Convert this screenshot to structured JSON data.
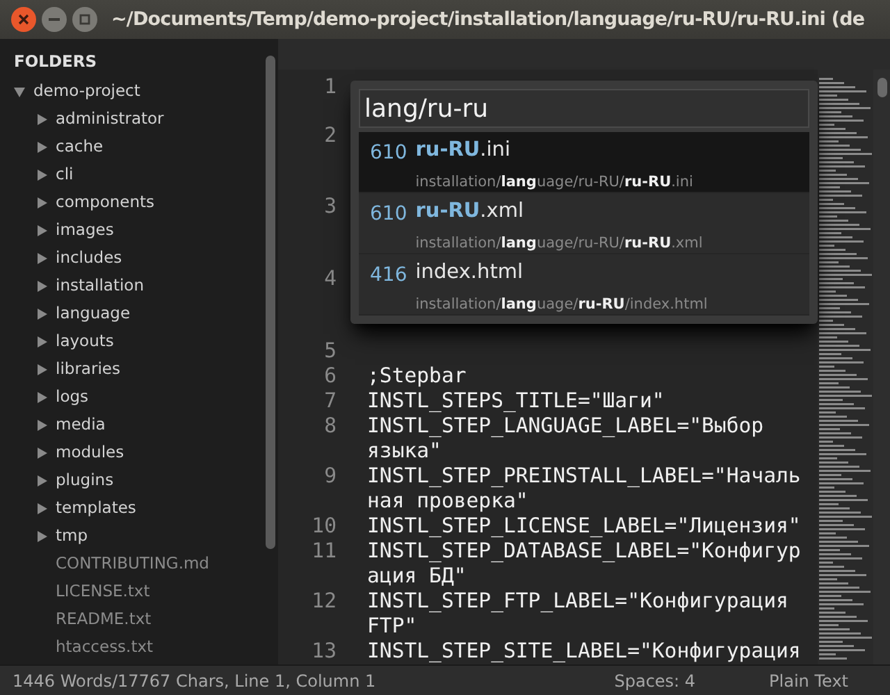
{
  "window": {
    "title": "~/Documents/Temp/demo-project/installation/language/ru-RU/ru-RU.ini (de"
  },
  "sidebar": {
    "heading": "FOLDERS",
    "tree": [
      {
        "label": "demo-project",
        "kind": "folder",
        "expanded": true,
        "children": [
          {
            "label": "administrator",
            "kind": "folder",
            "expanded": false
          },
          {
            "label": "cache",
            "kind": "folder",
            "expanded": false
          },
          {
            "label": "cli",
            "kind": "folder",
            "expanded": false
          },
          {
            "label": "components",
            "kind": "folder",
            "expanded": false
          },
          {
            "label": "images",
            "kind": "folder",
            "expanded": false
          },
          {
            "label": "includes",
            "kind": "folder",
            "expanded": false
          },
          {
            "label": "installation",
            "kind": "folder",
            "expanded": false
          },
          {
            "label": "language",
            "kind": "folder",
            "expanded": false
          },
          {
            "label": "layouts",
            "kind": "folder",
            "expanded": false
          },
          {
            "label": "libraries",
            "kind": "folder",
            "expanded": false
          },
          {
            "label": "logs",
            "kind": "folder",
            "expanded": false
          },
          {
            "label": "media",
            "kind": "folder",
            "expanded": false
          },
          {
            "label": "modules",
            "kind": "folder",
            "expanded": false
          },
          {
            "label": "plugins",
            "kind": "folder",
            "expanded": false
          },
          {
            "label": "templates",
            "kind": "folder",
            "expanded": false
          },
          {
            "label": "tmp",
            "kind": "folder",
            "expanded": false
          },
          {
            "label": "CONTRIBUTING.md",
            "kind": "file"
          },
          {
            "label": "LICENSE.txt",
            "kind": "file"
          },
          {
            "label": "README.txt",
            "kind": "file"
          },
          {
            "label": "htaccess.txt",
            "kind": "file"
          }
        ]
      }
    ]
  },
  "editor": {
    "lines": [
      {
        "number": "1"
      },
      {
        "number": "2"
      },
      {
        "number": "3"
      },
      {
        "number": "4"
      },
      {
        "number": "5"
      },
      {
        "number": "6",
        "code": ";Stepbar"
      },
      {
        "number": "7",
        "code": "INSTL_STEPS_TITLE=\"Шаги\""
      },
      {
        "number": "8",
        "code": "INSTL_STEP_LANGUAGE_LABEL=\"Выбор языка\""
      },
      {
        "number": "9",
        "code": "INSTL_STEP_PREINSTALL_LABEL=\"Начальная проверка\""
      },
      {
        "number": "10",
        "code": "INSTL_STEP_LICENSE_LABEL=\"Лицензия\""
      },
      {
        "number": "11",
        "code": "INSTL_STEP_DATABASE_LABEL=\"Конфигурация БД\""
      },
      {
        "number": "12",
        "code": "INSTL_STEP_FTP_LABEL=\"Конфигурация FTP\""
      },
      {
        "number": "13",
        "code": "INSTL_STEP_SITE_LABEL=\"Конфигурация"
      }
    ]
  },
  "goto_anything": {
    "query": "lang/ru-ru",
    "results": [
      {
        "score": "610",
        "name": "**ru-RU**.ini",
        "path": "installation/**lang**uage/ru-RU/**ru-RU**.ini",
        "selected": true
      },
      {
        "score": "610",
        "name": "**ru-RU**.xml",
        "path": "installation/**lang**uage/ru-RU/**ru-RU**.xml",
        "selected": false
      },
      {
        "score": "416",
        "name": "index.html",
        "path": "installation/**lang**uage/**ru-RU**/index.html",
        "selected": false
      }
    ]
  },
  "status_bar": {
    "position": "1446 Words/17767 Chars, Line 1, Column 1",
    "indentation": "Spaces: 4",
    "syntax": "Plain Text"
  }
}
